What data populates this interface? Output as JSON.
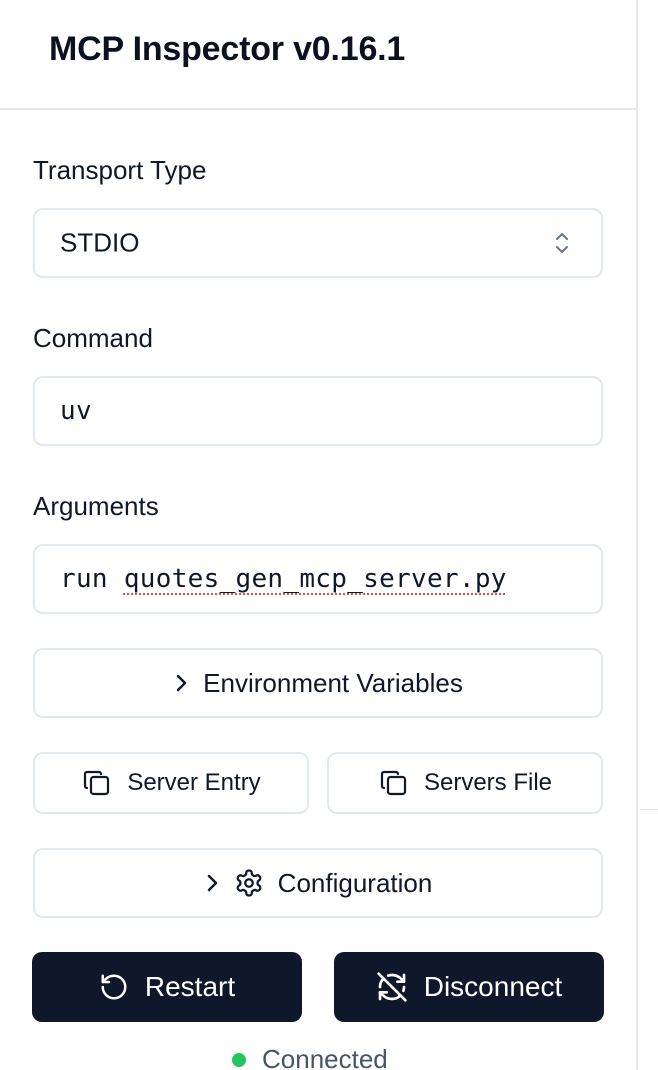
{
  "header": {
    "title": "MCP Inspector v0.16.1"
  },
  "transport": {
    "label": "Transport Type",
    "value": "STDIO"
  },
  "command": {
    "label": "Command",
    "value": "uv"
  },
  "arguments": {
    "label": "Arguments",
    "value_prefix": "run",
    "value_file": "quotes_gen_mcp_server.py"
  },
  "env": {
    "label": "Environment Variables"
  },
  "server_entry": {
    "label": "Server Entry"
  },
  "servers_file": {
    "label": "Servers File"
  },
  "configuration": {
    "label": "Configuration"
  },
  "restart": {
    "label": "Restart"
  },
  "disconnect": {
    "label": "Disconnect"
  },
  "status": {
    "label": "Connected",
    "color": "#22c55e"
  },
  "icons": {
    "select": "chevron-up-down-icon",
    "expand": "chevron-right-icon",
    "copy": "copy-icon",
    "settings": "gear-icon",
    "restart": "rotate-ccw-icon",
    "disconnect": "refresh-off-icon"
  }
}
